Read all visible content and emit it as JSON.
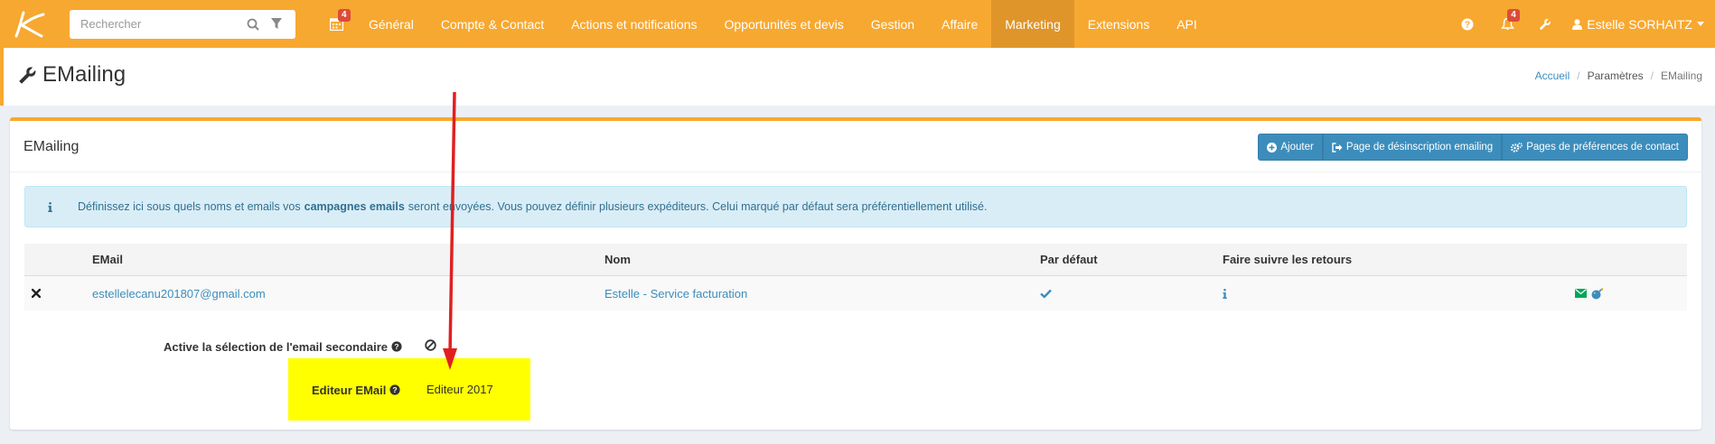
{
  "search": {
    "placeholder": "Rechercher"
  },
  "badges": {
    "calendar": "4",
    "notifications": "4"
  },
  "nav": [
    "Général",
    "Compte & Contact",
    "Actions et notifications",
    "Opportunités et devis",
    "Gestion",
    "Affaire",
    "Marketing",
    "Extensions",
    "API"
  ],
  "nav_active": "Marketing",
  "user": {
    "name": "Estelle SORHAITZ"
  },
  "page": {
    "title": "EMailing"
  },
  "breadcrumb": {
    "home": "Accueil",
    "section": "Paramètres",
    "current": "EMailing"
  },
  "box": {
    "title": "EMailing",
    "buttons": {
      "add": "Ajouter",
      "unsubscribe": "Page de désinscription emailing",
      "preferences": "Pages de préférences de contact"
    }
  },
  "callout": {
    "before": "Définissez ici sous quels noms et emails vos",
    "bold": "campagnes emails",
    "after": "seront envoyées. Vous pouvez définir plusieurs expéditeurs. Celui marqué par défaut sera préférentiellement utilisé."
  },
  "table": {
    "headers": {
      "email": "EMail",
      "name": "Nom",
      "default": "Par défaut",
      "forward": "Faire suivre les retours"
    },
    "rows": [
      {
        "email": "estellelecanu201807@gmail.com",
        "name": "Estelle - Service facturation"
      }
    ]
  },
  "form": {
    "secondary_label": "Active la sélection de l'email secondaire",
    "editor_label": "Editeur EMail",
    "editor_value": "Editeur 2017"
  },
  "icons": {
    "logo": "logo-k-icon",
    "search": "search-icon",
    "filter": "filter-icon",
    "calendar": "calendar-icon",
    "help": "question-circle-icon",
    "bell": "bell-icon",
    "wrench": "wrench-icon",
    "user": "user-icon",
    "add": "plus-circle-icon",
    "external": "sign-out-icon",
    "cogs": "cogs-icon",
    "info": "info-icon",
    "delete": "times-icon",
    "check": "check-icon",
    "envelope": "envelope-icon",
    "bomb": "bomb-icon",
    "ban": "ban-icon",
    "arrow": "red-arrow-annotation"
  },
  "colors": {
    "topbar": "#f7a830",
    "active_nav": "#df952a",
    "primary": "#3c8dbc",
    "callout_bg": "#d9edf7",
    "highlight": "#ffff00",
    "arrow": "#e02020",
    "danger": "#dd4b39"
  }
}
